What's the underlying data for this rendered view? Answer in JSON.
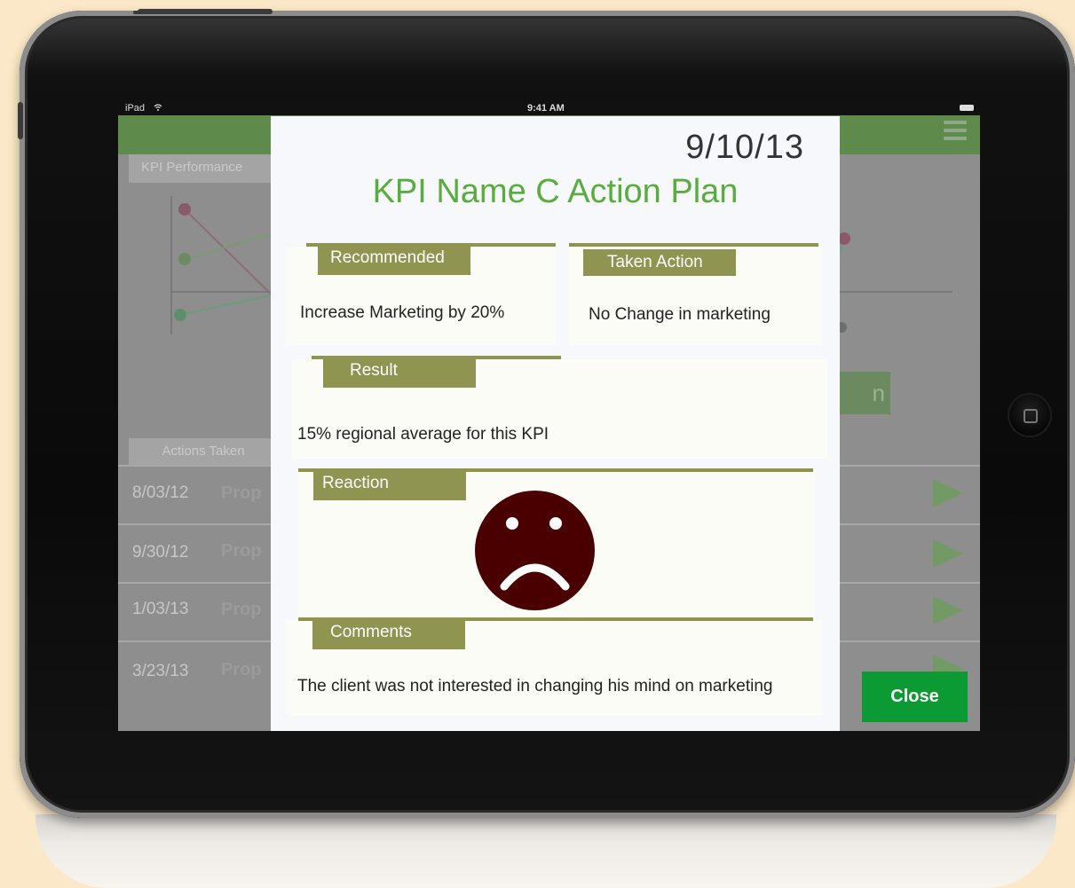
{
  "device": {
    "status_bar": {
      "carrier": "iPad",
      "time": "9:41 AM"
    }
  },
  "background": {
    "kpi_performance_tab": "KPI Performance",
    "actions_taken_tab": "Actions Taken",
    "rows": [
      {
        "date": "8/03/12",
        "prop": "Prop"
      },
      {
        "date": "9/30/12",
        "prop": "Prop"
      },
      {
        "date": "1/03/13",
        "prop": "Prop"
      },
      {
        "date": "3/23/13",
        "prop": "Prop"
      }
    ],
    "partial_button_text": "n"
  },
  "modal": {
    "date": "9/10/13",
    "title": "KPI Name C Action Plan",
    "recommended": {
      "label": "Recommended",
      "text": "Increase Marketing by 20%"
    },
    "taken_action": {
      "label": "Taken Action",
      "text": "No Change in marketing"
    },
    "result": {
      "label": "Result",
      "text": "15% regional average for this KPI"
    },
    "reaction": {
      "label": "Reaction",
      "face": "sad-face-icon",
      "color": "#4b0000"
    },
    "comments": {
      "label": "Comments",
      "text": "The client was not interested in changing his mind on marketing"
    }
  },
  "close_button": {
    "label": "Close",
    "color": "#0b9a34"
  },
  "colors": {
    "accent_green": "#5aac3f",
    "olive": "#8f9451",
    "header_green": "#5e8a4c"
  }
}
